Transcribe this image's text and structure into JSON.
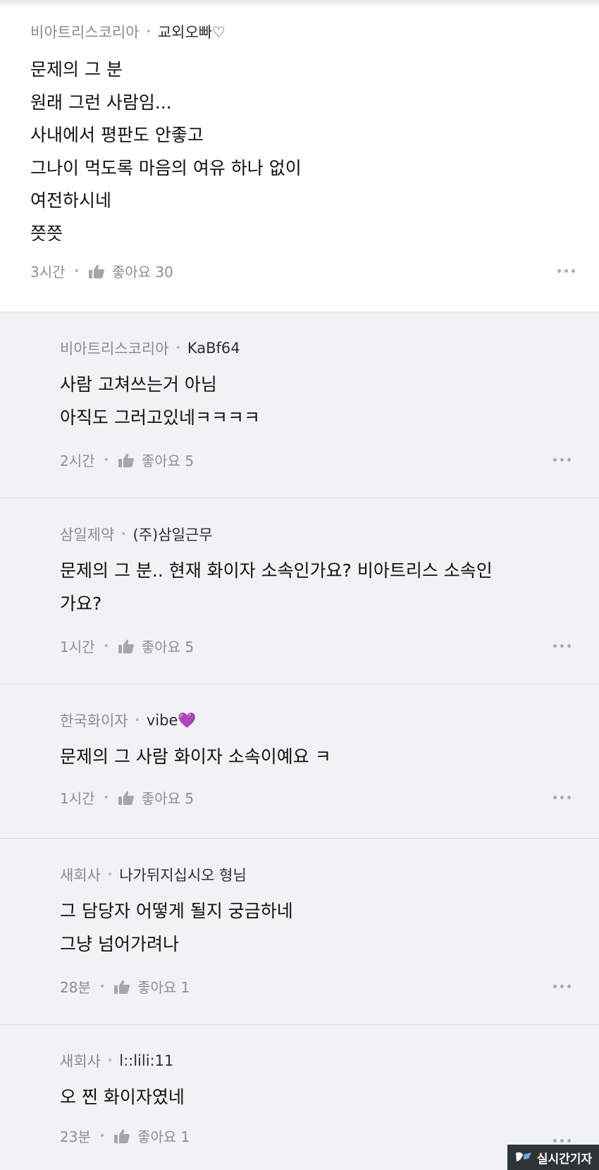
{
  "parent_comment": {
    "company": "비아트리스코리아",
    "nickname": "교외오빠♡",
    "lines": [
      "문제의 그 분",
      "원래 그런 사람임...",
      "사내에서 평판도 안좋고",
      "그나이 먹도록 마음의 여유 하나 없이",
      "여전하시네",
      "쯧쯧"
    ],
    "time": "3시간",
    "likes": "좋아요 30"
  },
  "replies": [
    {
      "company": "비아트리스코리아",
      "nickname": "KaBf64",
      "lines": [
        "사람 고쳐쓰는거 아님",
        "아직도 그러고있네ㅋㅋㅋㅋ"
      ],
      "time": "2시간",
      "likes": "좋아요 5"
    },
    {
      "company": "삼일제약",
      "nickname": "(주)삼일근무",
      "lines": [
        "문제의 그 분.. 현재 화이자 소속인가요? 비아트리스 소속인",
        "가요?"
      ],
      "time": "1시간",
      "likes": "좋아요 5"
    },
    {
      "company": "한국화이자",
      "nickname": "vibe💜",
      "lines": [
        "문제의 그 사람 화이자 소속이예요 ㅋ"
      ],
      "time": "1시간",
      "likes": "좋아요 5"
    },
    {
      "company": "새회사",
      "nickname": "나가뒤지십시오 형님",
      "lines": [
        "그 담당자 어떻게 될지 궁금하네",
        "그냥 넘어가려나"
      ],
      "time": "28분",
      "likes": "좋아요 1"
    },
    {
      "company": "새회사",
      "nickname": "l::lili:11",
      "lines": [
        "오 찐 화이자였네"
      ],
      "time": "23분",
      "likes": "좋아요 1"
    }
  ],
  "separator": "•",
  "icons": {
    "like": "thumbs-up-icon",
    "more": "more-horizontal-icon"
  },
  "watermark": {
    "text": "실시간기자"
  }
}
